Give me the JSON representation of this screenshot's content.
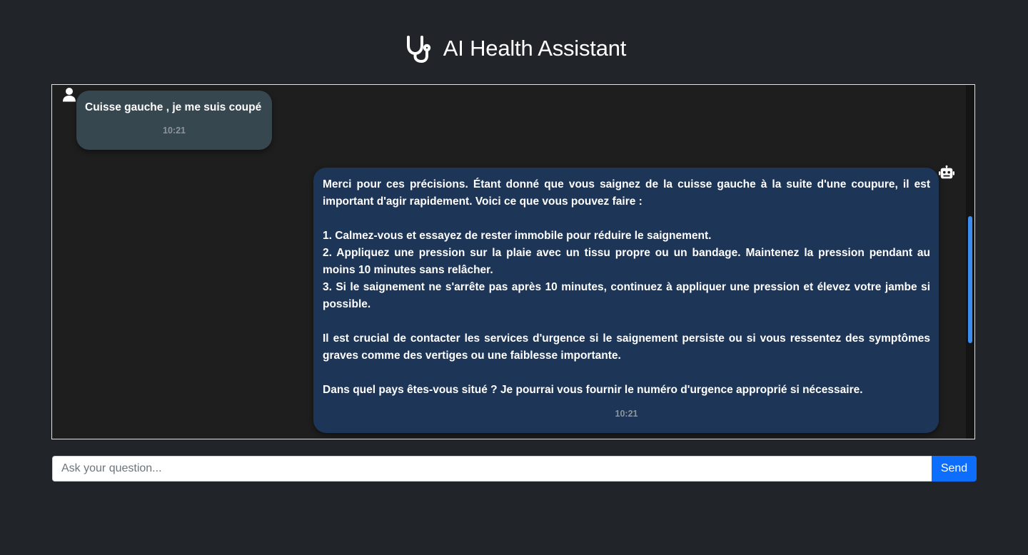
{
  "header": {
    "title": "AI Health Assistant",
    "logo_icon": "stethoscope-icon"
  },
  "messages": [
    {
      "role": "user",
      "avatar_icon": "user-icon",
      "text": "Cuisse gauche , je me suis coupé",
      "time": "10:21"
    },
    {
      "role": "bot",
      "avatar_icon": "robot-icon",
      "text": "Merci pour ces précisions. Étant donné que vous saignez de la cuisse gauche à la suite d'une coupure, il est important d'agir rapidement. Voici ce que vous pouvez faire :\n\n1. Calmez-vous et essayez de rester immobile pour réduire le saignement.\n2. Appliquez une pression sur la plaie avec un tissu propre ou un bandage. Maintenez la pression pendant au moins 10 minutes sans relâcher.\n3. Si le saignement ne s'arrête pas après 10 minutes, continuez à appliquer une pression et élevez votre jambe si possible.\n\nIl est crucial de contacter les services d'urgence si le saignement persiste ou si vous ressentez des symptômes graves comme des vertiges ou une faiblesse importante.\n\nDans quel pays êtes-vous situé ? Je pourrai vous fournir le numéro d'urgence approprié si nécessaire.",
      "time": "10:21"
    }
  ],
  "composer": {
    "placeholder": "Ask your question...",
    "value": "",
    "send_label": "Send"
  },
  "colors": {
    "background": "#212529",
    "chat_background": "#1e1e1e",
    "user_bubble": "#37474f",
    "bot_bubble": "#1d3557",
    "send_button": "#0d6efd",
    "scrollbar_thumb": "#3b8df0"
  }
}
